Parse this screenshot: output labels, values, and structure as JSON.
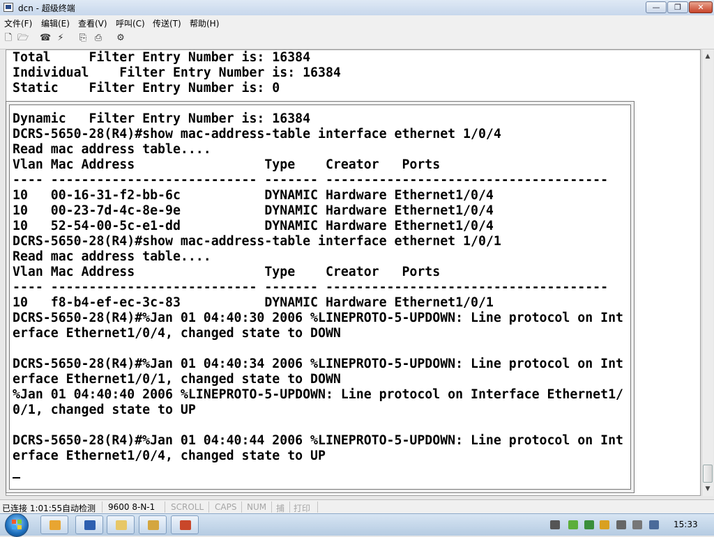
{
  "window": {
    "title": "dcn - 超级终端"
  },
  "menu": [
    "文件(F)",
    "编辑(E)",
    "查看(V)",
    "呼叫(C)",
    "传送(T)",
    "帮助(H)"
  ],
  "toolbar": [
    "new-icon",
    "open-icon",
    "phone-icon",
    "disconnect-icon",
    "send-icon",
    "receive-icon",
    "properties-icon"
  ],
  "terminal": {
    "top_text": "Total     Filter Entry Number is: 16384\nIndividual    Filter Entry Number is: 16384\nStatic    Filter Entry Number is: 0",
    "main_text": "Dynamic   Filter Entry Number is: 16384\nDCRS-5650-28(R4)#show mac-address-table interface ethernet 1/0/4\nRead mac address table....\nVlan Mac Address                 Type    Creator   Ports\n---- --------------------------- ------- -------------------------------------\n10   00-16-31-f2-bb-6c           DYNAMIC Hardware Ethernet1/0/4\n10   00-23-7d-4c-8e-9e           DYNAMIC Hardware Ethernet1/0/4\n10   52-54-00-5c-e1-dd           DYNAMIC Hardware Ethernet1/0/4\nDCRS-5650-28(R4)#show mac-address-table interface ethernet 1/0/1\nRead mac address table....\nVlan Mac Address                 Type    Creator   Ports\n---- --------------------------- ------- -------------------------------------\n10   f8-b4-ef-ec-3c-83           DYNAMIC Hardware Ethernet1/0/1\nDCRS-5650-28(R4)#%Jan 01 04:40:30 2006 %LINEPROTO-5-UPDOWN: Line protocol on Int\nerface Ethernet1/0/4, changed state to DOWN\n\nDCRS-5650-28(R4)#%Jan 01 04:40:34 2006 %LINEPROTO-5-UPDOWN: Line protocol on Int\nerface Ethernet1/0/1, changed state to DOWN\n%Jan 01 04:40:40 2006 %LINEPROTO-5-UPDOWN: Line protocol on Interface Ethernet1/\n0/1, changed state to UP\n\nDCRS-5650-28(R4)#%Jan 01 04:40:44 2006 %LINEPROTO-5-UPDOWN: Line protocol on Int\nerface Ethernet1/0/4, changed state to UP"
  },
  "status": {
    "connection": "已连接 1:01:55",
    "detect": "自动检测",
    "settings": "9600 8-N-1",
    "scroll": "SCROLL",
    "caps": "CAPS",
    "num": "NUM",
    "capture": "捕",
    "print": "打印"
  },
  "taskbar": {
    "apps": [
      "ie-icon",
      "word-icon",
      "explorer-icon",
      "hyperterminal-icon",
      "powerpoint-icon"
    ],
    "clock": "15:33"
  },
  "colors": {
    "terminal_bg": "#ffffff",
    "text": "#000000",
    "titlebar": "#c7d7ec"
  }
}
